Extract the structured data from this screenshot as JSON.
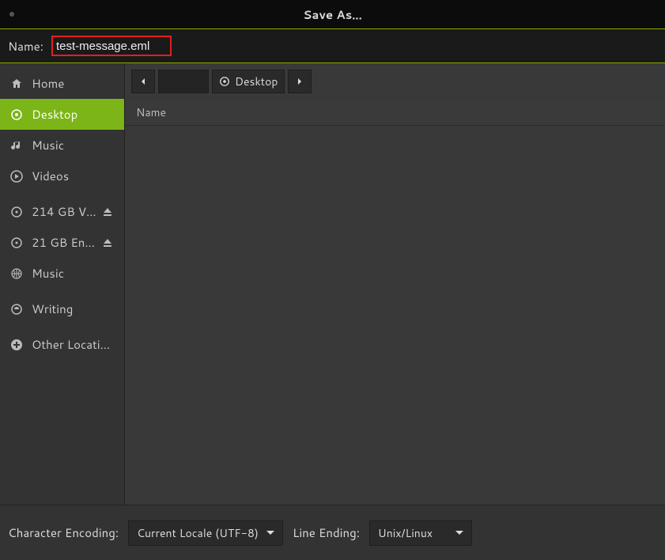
{
  "window": {
    "title": "Save As..."
  },
  "name": {
    "label": "Name:",
    "value": "test-message.eml"
  },
  "sidebar": {
    "items": [
      {
        "label": "Home",
        "icon": "home-icon",
        "selected": false,
        "eject": false
      },
      {
        "label": "Desktop",
        "icon": "desktop-icon",
        "selected": true,
        "eject": false
      },
      {
        "label": "Music",
        "icon": "music-icon",
        "selected": false,
        "eject": false
      },
      {
        "label": "Videos",
        "icon": "video-icon",
        "selected": false,
        "eject": false
      },
      {
        "label": "214 GB V…",
        "icon": "drive-icon",
        "selected": false,
        "eject": true
      },
      {
        "label": "21 GB En…",
        "icon": "drive-icon",
        "selected": false,
        "eject": true
      },
      {
        "label": "Music",
        "icon": "network-icon",
        "selected": false,
        "eject": false
      },
      {
        "label": "Writing",
        "icon": "folder-remote-icon",
        "selected": false,
        "eject": false
      },
      {
        "label": "Other Locations",
        "icon": "plus-icon",
        "selected": false,
        "eject": false
      }
    ]
  },
  "pathbar": {
    "current": "Desktop"
  },
  "list": {
    "header": "Name"
  },
  "footer": {
    "encoding_label": "Character Encoding:",
    "encoding_value": "Current Locale (UTF-8)",
    "lineending_label": "Line Ending:",
    "lineending_value": "Unix/Linux"
  }
}
